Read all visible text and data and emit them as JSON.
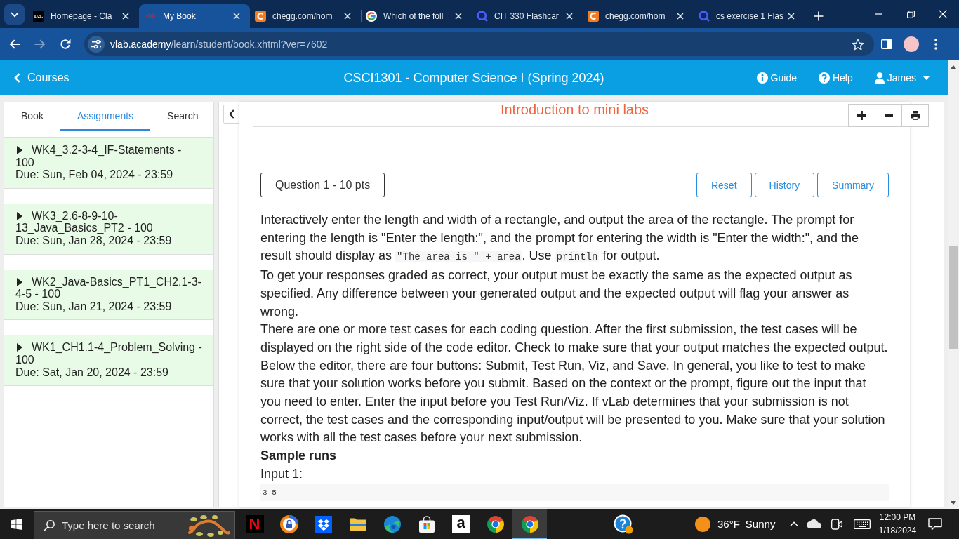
{
  "browser": {
    "tabs": [
      {
        "title": "Homepage - Cla",
        "favicon": {
          "kind": "d2l",
          "text": "D2L"
        },
        "selected": false
      },
      {
        "title": "My Book",
        "favicon": {
          "kind": "vlab",
          "text": "vlab"
        },
        "selected": true
      },
      {
        "title": "chegg.com/hom",
        "favicon": {
          "kind": "chegg"
        },
        "selected": false
      },
      {
        "title": "Which of the foll",
        "favicon": {
          "kind": "google"
        },
        "selected": false
      },
      {
        "title": "CIT 330 Flashcar",
        "favicon": {
          "kind": "quizlet"
        },
        "selected": false
      },
      {
        "title": "chegg.com/hom",
        "favicon": {
          "kind": "chegg"
        },
        "selected": false
      },
      {
        "title": "cs exercise 1 Flas",
        "favicon": {
          "kind": "quizlet"
        },
        "selected": false
      }
    ],
    "back": {
      "disabled": false
    },
    "forward": {
      "disabled": true
    },
    "address": {
      "host": "vlab.academy",
      "path": "/learn/student/book.xhtml?ver=7602"
    }
  },
  "app_header": {
    "back_label": "Courses",
    "title": "CSCI1301 - Computer Science I (Spring 2024)",
    "links": [
      {
        "kind": "guide",
        "label": "Guide"
      },
      {
        "kind": "help",
        "label": "Help"
      },
      {
        "kind": "user",
        "label": "James"
      }
    ]
  },
  "sidebar": {
    "tabs": [
      {
        "label": "Book",
        "selected": false
      },
      {
        "label": "Assignments",
        "selected": true
      },
      {
        "label": "Search",
        "selected": false
      }
    ],
    "assignments": [
      {
        "title": "WK4_3.2-3-4_IF-Statements - 100",
        "due": "Due: Sun, Feb 04, 2024 - 23:59",
        "expanded": false
      },
      {
        "title": "WK3_2.6-8-9-10-13_Java_Basics_PT2 - 100",
        "due": "Due: Sun, Jan 28, 2024 - 23:59",
        "expanded": false
      },
      {
        "title": "WK2_Java-Basics_PT1_CH2.1-3-4-5 - 100",
        "due": "Due: Sun, Jan 21, 2024 - 23:59",
        "expanded": false
      },
      {
        "title": "WK1_CH1.1-4_Problem_Solving - 100",
        "due": "Due: Sat, Jan 20, 2024 - 23:59",
        "expanded": false
      }
    ]
  },
  "content": {
    "title": "Introduction to mini labs",
    "question": "Question 1 - 10 pts",
    "buttons": [
      "Reset",
      "History",
      "Summary"
    ],
    "blocks": [
      {
        "kind": "paragraph",
        "segments": [
          {
            "kind": "text",
            "text": "Interactively enter the length and width of a rectangle, and output the area of the rectangle. The prompt for entering the length is \"Enter the length:\", and the prompt for entering the width is \"Enter the width:\", and the result should display as "
          },
          {
            "kind": "code",
            "text": "\"The area is \" + area"
          },
          {
            "kind": "text",
            "text": ". Use "
          },
          {
            "kind": "code",
            "text": "println"
          },
          {
            "kind": "text",
            "text": " for output."
          }
        ]
      },
      {
        "kind": "paragraph",
        "segments": [
          {
            "kind": "text",
            "text": "To get your responses graded as correct, your output must be exactly the same as the expected output as specified. Any difference between your generated output and the expected output will flag your answer as wrong."
          }
        ]
      },
      {
        "kind": "paragraph",
        "segments": [
          {
            "kind": "text",
            "text": "There are one or more test cases for each coding question. After the first submission, the test cases will be displayed on the right side of the code editor. Check to make sure that your output matches the expected output. Below the editor, there are four buttons: Submit, Test Run, Viz, and Save. In general, you like to test to make sure that your solution works before you submit. Based on the context or the prompt, figure out the input that you need to enter. Enter the input before you Test Run/Viz. If vLab determines that your submission is not correct, the test cases and the corresponding input/output will be presented to you. Make sure that your solution works with all the test cases before your next submission."
          }
        ]
      },
      {
        "kind": "heading",
        "text": "Sample runs"
      },
      {
        "kind": "label",
        "text": "Input 1:"
      },
      {
        "kind": "code_block",
        "text": "3 5"
      }
    ]
  },
  "taskbar": {
    "search": {
      "placeholder": "Type here to search"
    },
    "apps": [
      {
        "kind": "netflix",
        "glyph": "N",
        "selected": false
      },
      {
        "kind": "secure-browser",
        "selected": false
      },
      {
        "kind": "dropbox",
        "selected": false
      },
      {
        "kind": "files",
        "selected": false
      },
      {
        "kind": "edge",
        "selected": false
      },
      {
        "kind": "store",
        "selected": false
      },
      {
        "kind": "amazon",
        "glyph": "a",
        "selected": false
      },
      {
        "kind": "chrome",
        "selected": false
      },
      {
        "kind": "chrome",
        "selected": true
      }
    ],
    "weather": {
      "temperature": "36°F",
      "condition": "Sunny"
    },
    "clock": {
      "time": "12:00 PM",
      "date": "1/18/2024"
    }
  }
}
